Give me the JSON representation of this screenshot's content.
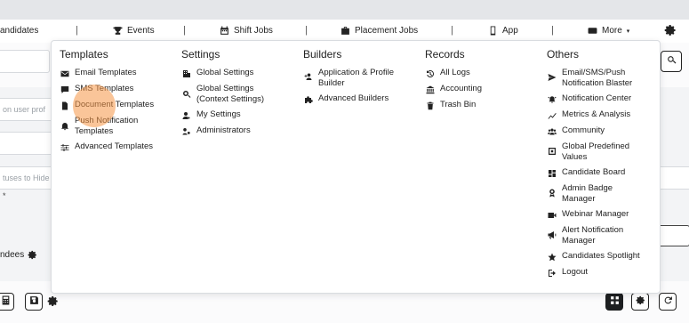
{
  "navbar": {
    "items": [
      {
        "label": "andidates",
        "icon": ""
      },
      {
        "label": "Events",
        "icon": "trophy-icon"
      },
      {
        "label": "Shift Jobs",
        "icon": "calendar-icon"
      },
      {
        "label": "Placement Jobs",
        "icon": "briefcase-icon"
      },
      {
        "label": "App",
        "icon": "mobile-icon"
      },
      {
        "label": "More",
        "icon": "tablet-icon"
      }
    ],
    "separator": "|"
  },
  "background": {
    "user_prof_placeholder": "on user prof",
    "statuses_placeholder": "tuses to Hide",
    "attendees_label": "ndees",
    "asterisk": "*"
  },
  "menu": {
    "columns": [
      {
        "title": "Templates",
        "items": [
          {
            "label": "Email Templates",
            "icon": "envelope-icon"
          },
          {
            "label": "SMS Templates",
            "icon": "sms-icon"
          },
          {
            "label": "Document Templates",
            "icon": "document-icon"
          },
          {
            "label": "Push Notification\nTemplates",
            "icon": "bell-icon"
          },
          {
            "label": "Advanced Templates",
            "icon": "sliders-icon"
          }
        ]
      },
      {
        "title": "Settings",
        "items": [
          {
            "label": "Global Settings",
            "icon": "building-icon"
          },
          {
            "label": "Global Settings\n(Context Settings)",
            "icon": "search-gear-icon"
          },
          {
            "label": "My Settings",
            "icon": "user-gear-icon"
          },
          {
            "label": "Administrators",
            "icon": "users-gear-icon"
          }
        ]
      },
      {
        "title": "Builders",
        "items": [
          {
            "label": "Application & Profile\nBuilder",
            "icon": "user-plus-icon"
          },
          {
            "label": "Advanced Builders",
            "icon": "puzzle-icon"
          }
        ]
      },
      {
        "title": "Records",
        "items": [
          {
            "label": "All Logs",
            "icon": "history-icon"
          },
          {
            "label": "Accounting",
            "icon": "bank-icon"
          },
          {
            "label": "Trash Bin",
            "icon": "trash-icon"
          }
        ]
      },
      {
        "title": "Others",
        "items": [
          {
            "label": "Email/SMS/Push\nNotification Blaster",
            "icon": "send-icon"
          },
          {
            "label": "Notification Center",
            "icon": "bell-ring-icon"
          },
          {
            "label": "Metrics & Analysis",
            "icon": "chart-line-icon"
          },
          {
            "label": "Community",
            "icon": "people-icon"
          },
          {
            "label": "Global Predefined\nValues",
            "icon": "square-dot-icon"
          },
          {
            "label": "Candidate Board",
            "icon": "dashboard-icon"
          },
          {
            "label": "Admin Badge\nManager",
            "icon": "award-icon"
          },
          {
            "label": "Webinar Manager",
            "icon": "video-icon"
          },
          {
            "label": "Alert Notification\nManager",
            "icon": "megaphone-icon"
          },
          {
            "label": "Candidates Spotlight",
            "icon": "star-icon"
          },
          {
            "label": "Logout",
            "icon": "logout-icon"
          }
        ]
      }
    ]
  },
  "colors": {
    "highlight": "#f59646",
    "text": "#222222"
  }
}
